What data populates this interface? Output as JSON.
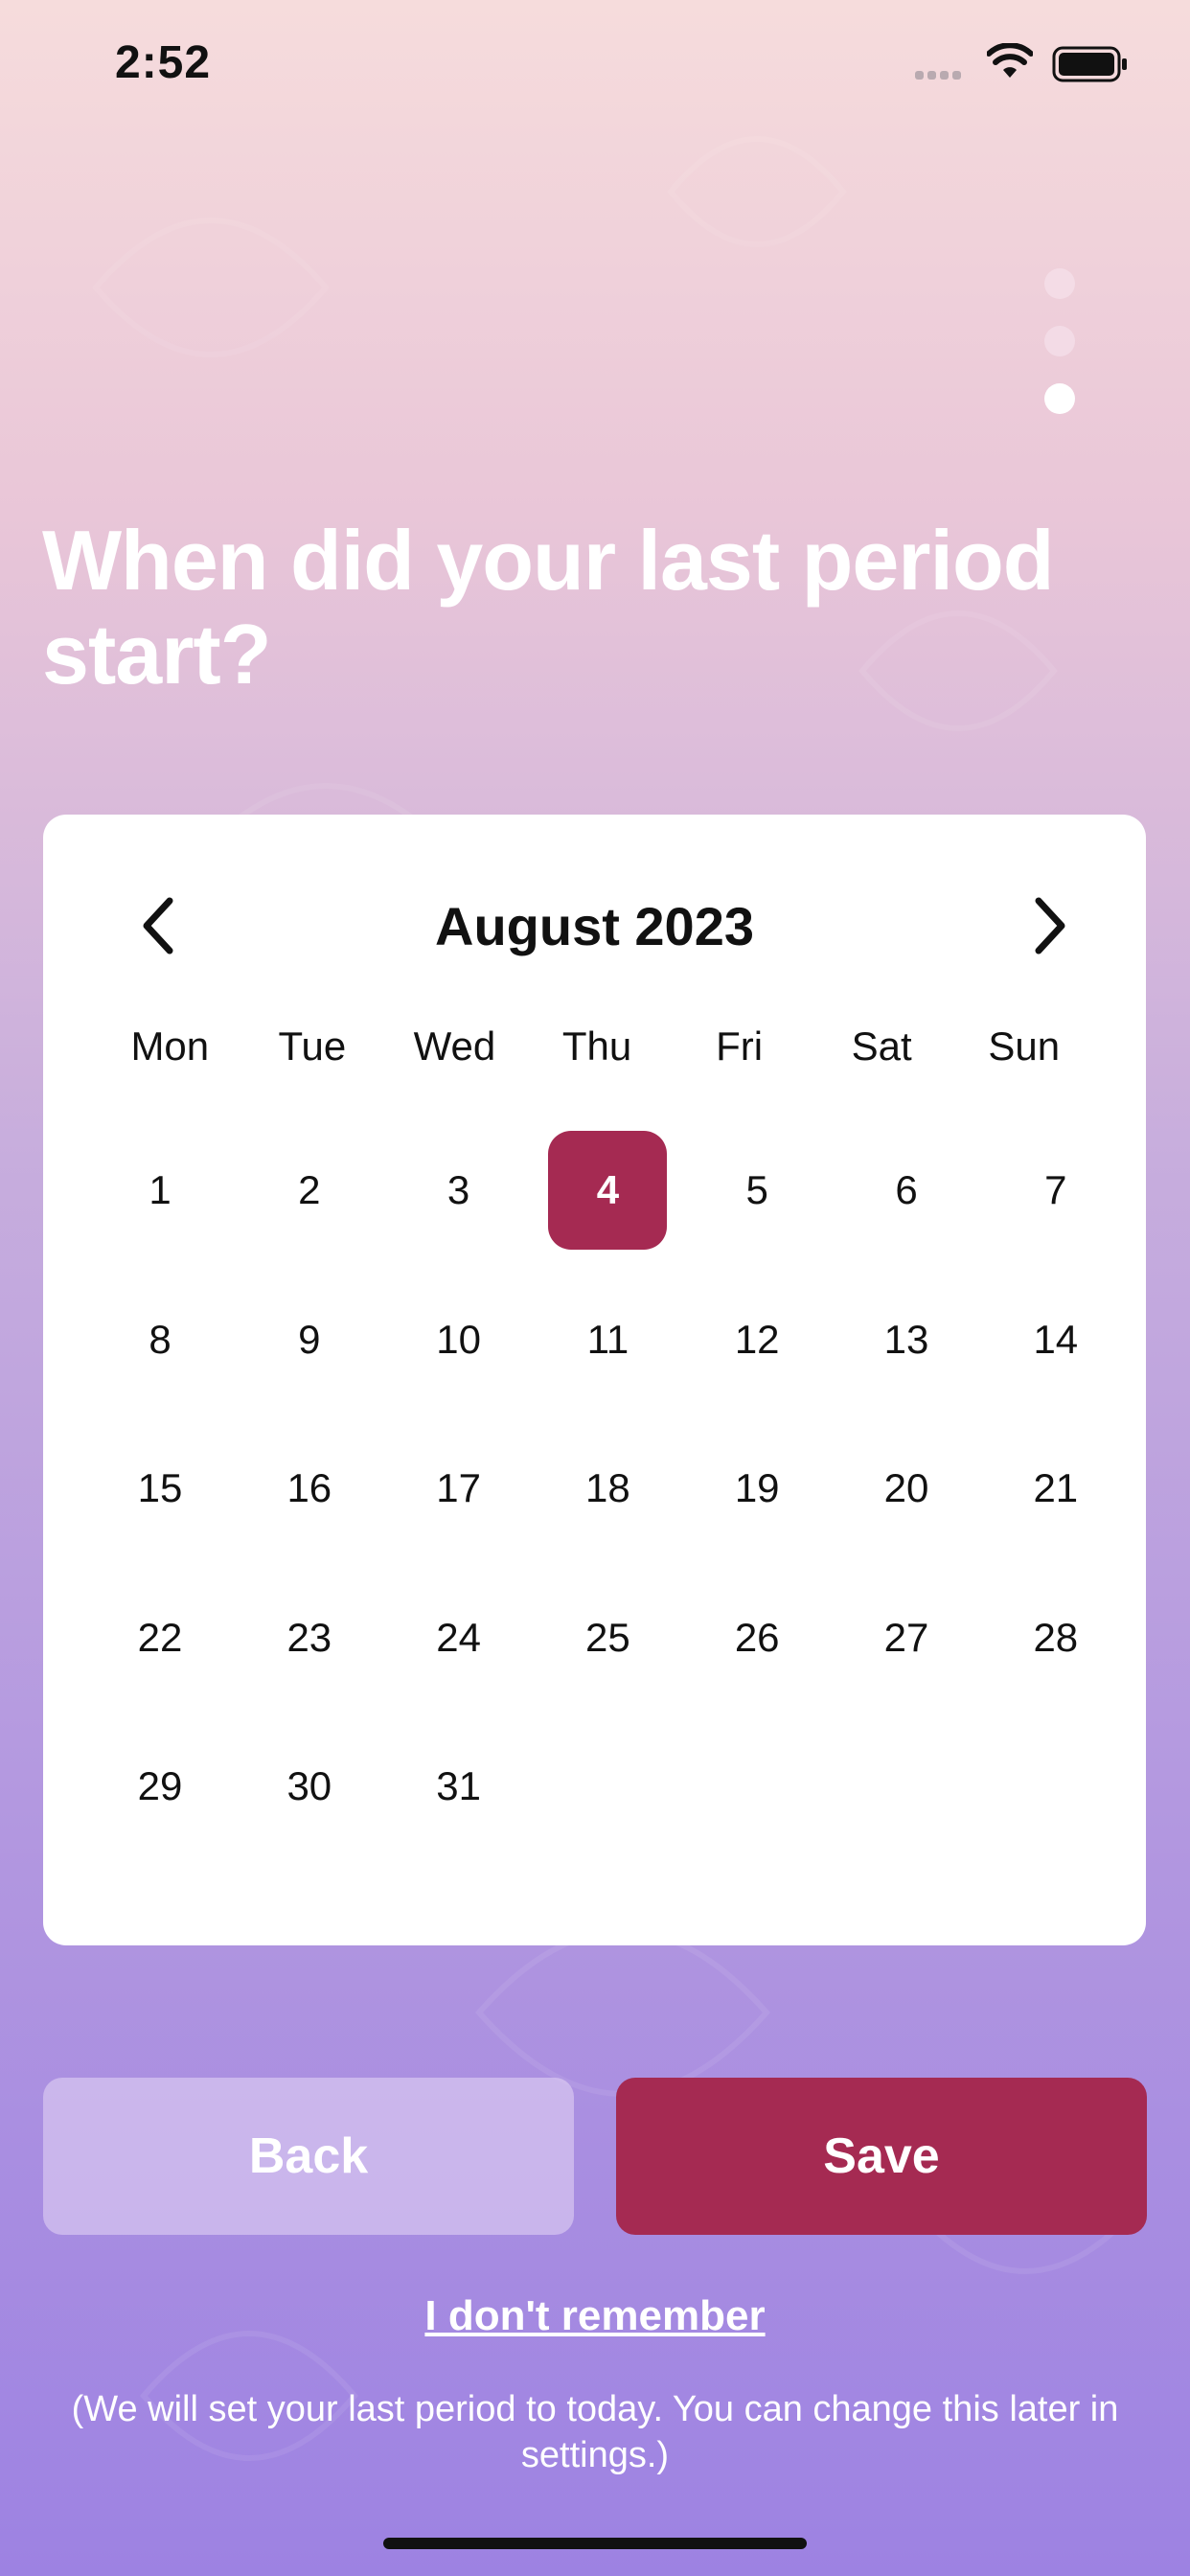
{
  "status_bar": {
    "time": "2:52"
  },
  "onboarding": {
    "page_count": 3,
    "current_page": 3
  },
  "title": "When did your last period start?",
  "calendar": {
    "month_label": "August 2023",
    "weekdays": [
      "Mon",
      "Tue",
      "Wed",
      "Thu",
      "Fri",
      "Sat",
      "Sun"
    ],
    "days": [
      "1",
      "2",
      "3",
      "4",
      "5",
      "6",
      "7",
      "8",
      "9",
      "10",
      "11",
      "12",
      "13",
      "14",
      "15",
      "16",
      "17",
      "18",
      "19",
      "20",
      "21",
      "22",
      "23",
      "24",
      "25",
      "26",
      "27",
      "28",
      "29",
      "30",
      "31"
    ],
    "first_weekday_index": 0,
    "selected_day": "4"
  },
  "buttons": {
    "back_label": "Back",
    "save_label": "Save"
  },
  "link_label": "I don't remember",
  "note": "(We will set your last period to today. You can change this later in settings.)",
  "colors": {
    "accent": "#a52a52",
    "text": "#111111",
    "dot_inactive": "#f6e4ee",
    "dot_active": "#ffffff"
  },
  "icons": [
    "signal-icon",
    "wifi-icon",
    "battery-icon",
    "chevron-left-icon",
    "chevron-right-icon"
  ]
}
